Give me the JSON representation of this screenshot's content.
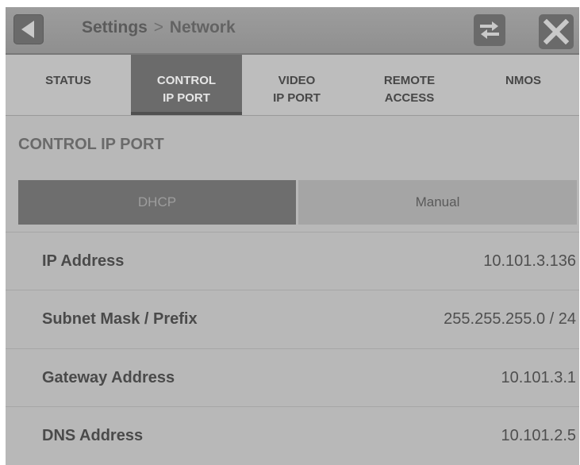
{
  "titlebar": {
    "crumb_parent": "Settings",
    "separator": ">",
    "crumb_current": "Network"
  },
  "tabs": [
    {
      "label": "STATUS",
      "active": false
    },
    {
      "label": "CONTROL\nIP PORT",
      "active": true
    },
    {
      "label": "VIDEO\nIP PORT",
      "active": false
    },
    {
      "label": "REMOTE\nACCESS",
      "active": false
    },
    {
      "label": "NMOS",
      "active": false
    }
  ],
  "section": {
    "title": "CONTROL IP PORT"
  },
  "mode": {
    "dhcp_label": "DHCP",
    "manual_label": "Manual",
    "selected": "DHCP"
  },
  "rows": [
    {
      "label": "IP Address",
      "value": "10.101.3.136"
    },
    {
      "label": "Subnet Mask / Prefix",
      "value": "255.255.255.0 / 24"
    },
    {
      "label": "Gateway Address",
      "value": "10.101.3.1"
    },
    {
      "label": "DNS Address",
      "value": "10.101.2.5"
    }
  ],
  "icons": {
    "back": "back-arrow-icon",
    "swap": "swap-arrows-icon",
    "close": "close-icon"
  },
  "colors": {
    "active_tab": "#6b6b6b",
    "background": "#b8b8b8"
  }
}
